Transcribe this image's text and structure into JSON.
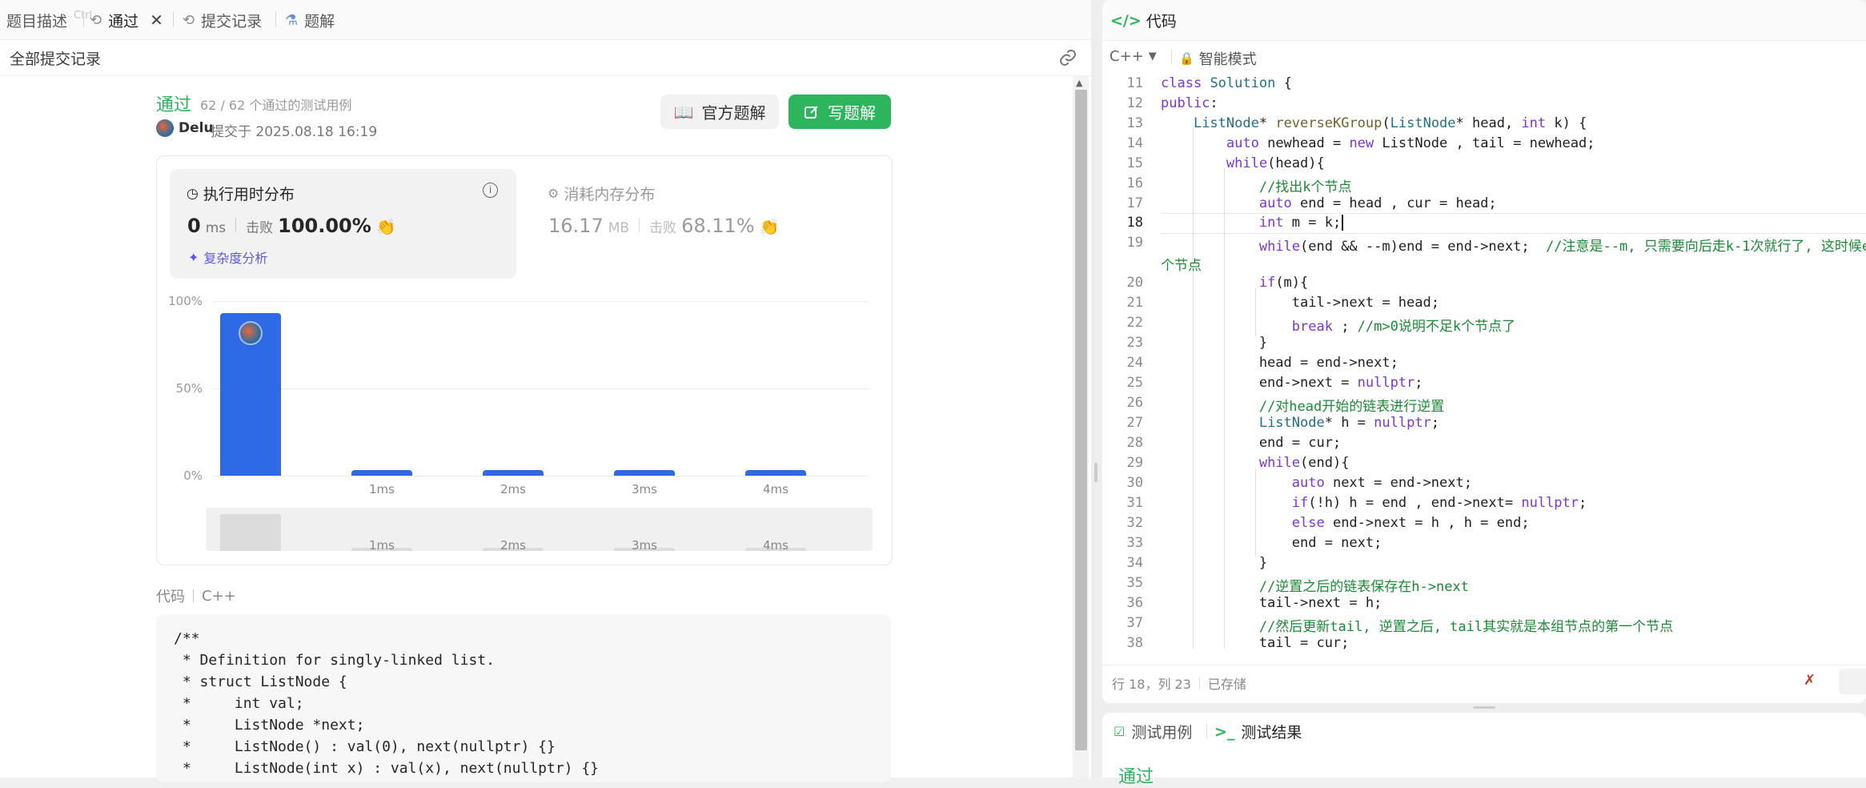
{
  "tabs": [
    {
      "label": "题目描述",
      "icon": "document-icon",
      "ghost": "Ctrl"
    },
    {
      "label": "通过",
      "icon": "history-icon"
    },
    {
      "label": "提交记录",
      "icon": "history-icon"
    },
    {
      "label": "题解",
      "icon": "flask-icon"
    }
  ],
  "subbar": {
    "title": "全部提交记录"
  },
  "submission": {
    "status": "通过",
    "cases": "62 / 62 个通过的测试用例",
    "user": "Delu",
    "submitted_at": "提交于 2025.08.18 16:19",
    "official_btn": "官方题解",
    "write_btn": "写题解"
  },
  "runtime": {
    "title": "执行用时分布",
    "value": "0",
    "unit": "ms",
    "beats_label": "击败",
    "beats": "100.00%",
    "complexity": "复杂度分析"
  },
  "memory": {
    "title": "消耗内存分布",
    "value": "16.17",
    "unit": "MB",
    "beats_label": "击败",
    "beats": "68.11%"
  },
  "chart_data": {
    "type": "bar",
    "categories": [
      "",
      "1ms",
      "2ms",
      "3ms",
      "4ms"
    ],
    "values": [
      93,
      3,
      3,
      3,
      3
    ],
    "yticks": [
      "100%",
      "50%",
      "0%"
    ],
    "ylim": [
      0,
      100
    ],
    "mini_labels": [
      "1ms",
      "2ms",
      "3ms",
      "4ms"
    ],
    "bar_color": "#2f6ae6"
  },
  "code_section": {
    "label": "代码",
    "lang": "C++"
  },
  "code_preview": [
    "/**",
    " * Definition for singly-linked list.",
    " * struct ListNode {",
    " *     int val;",
    " *     ListNode *next;",
    " *     ListNode() : val(0), next(nullptr) {}",
    " *     ListNode(int x) : val(x), next(nullptr) {}"
  ],
  "editor": {
    "title": "代码",
    "language": "C++",
    "mode": "智能模式",
    "status_position": "行 18，列 23",
    "status_saved": "已存储",
    "line_numbers": [
      "11",
      "12",
      "13",
      "14",
      "15",
      "16",
      "17",
      "18",
      "19",
      "",
      "20",
      "21",
      "22",
      "23",
      "24",
      "25",
      "26",
      "27",
      "28",
      "29",
      "30",
      "31",
      "32",
      "33",
      "34",
      "35",
      "36",
      "37",
      "38"
    ]
  },
  "bottom_tabs": {
    "testcase": "测试用例",
    "result": "测试结果",
    "partial": "通过"
  },
  "colors": {
    "accent_green": "#2db55d",
    "bar_blue": "#2f6ae6",
    "comment_green": "#1a8a35",
    "keyword_purple": "#7b36d6"
  }
}
